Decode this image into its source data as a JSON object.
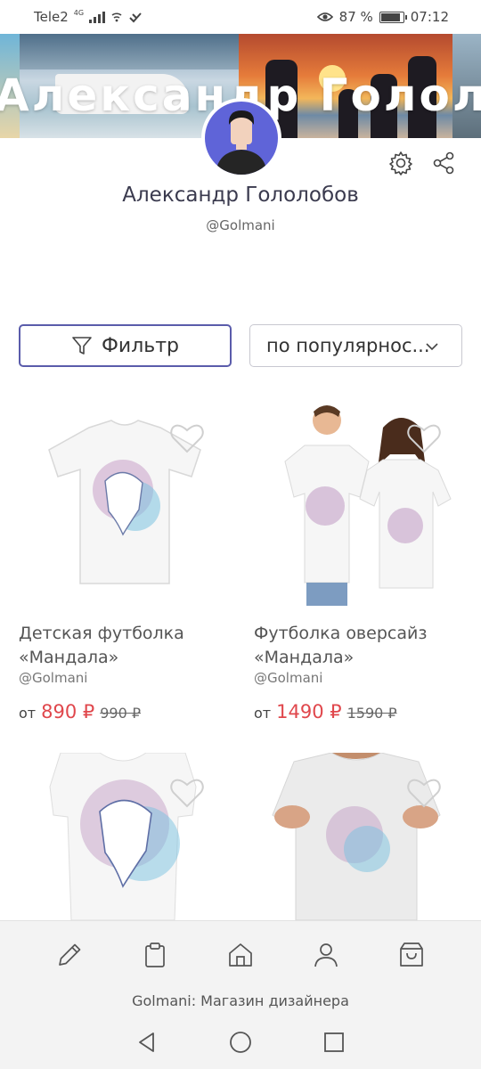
{
  "status_bar": {
    "carrier": "Tele2",
    "network": "4G",
    "battery_percent": "87 %",
    "battery_level": 0.87,
    "time": "07:12"
  },
  "banner": {
    "title": "Александр Гололобов"
  },
  "profile": {
    "name": "Александр Гололобов",
    "handle": "@Golmani"
  },
  "toolbar": {
    "filter_label": "Фильтр",
    "sort_label": "по популярнос..."
  },
  "products": [
    {
      "title": "Детская футболка «Мандала»",
      "author": "@Golmani",
      "price_prefix": "от",
      "price": "890 ₽",
      "old_price": "990 ₽"
    },
    {
      "title": "Футболка оверсайз «Мандала»",
      "author": "@Golmani",
      "price_prefix": "от",
      "price": "1490 ₽",
      "old_price": "1590 ₽"
    },
    {},
    {}
  ],
  "bottom_nav": {
    "items": [
      "pencil-icon",
      "clipboard-icon",
      "home-icon",
      "user-icon",
      "bag-icon"
    ]
  },
  "shop_caption": "Golmani: Магазин дизайнера",
  "colors": {
    "accent": "#5a5cab",
    "price": "#e0474c",
    "avatar_bg": "#5f64d8"
  }
}
